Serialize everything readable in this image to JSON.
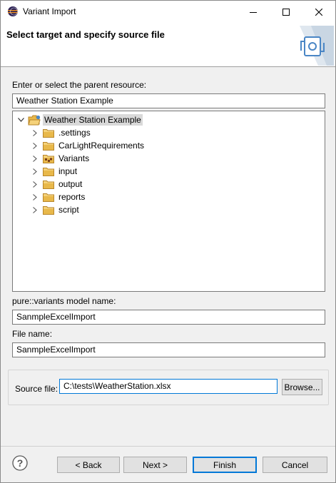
{
  "window": {
    "title": "Variant Import",
    "icon": "eclipse-icon"
  },
  "banner": {
    "title": "Select target and specify source file",
    "graphic": "import-wizard-icon"
  },
  "parent_resource": {
    "label": "Enter or select the parent resource:",
    "value": "Weather Station Example"
  },
  "tree": {
    "root": {
      "label": "Weather Station Example",
      "expanded": true,
      "icon": "open-project-folder-icon"
    },
    "children": [
      {
        "label": ".settings",
        "icon": "folder-icon"
      },
      {
        "label": "CarLightRequirements",
        "icon": "folder-icon"
      },
      {
        "label": "Variants",
        "icon": "variants-folder-icon"
      },
      {
        "label": "input",
        "icon": "folder-icon"
      },
      {
        "label": "output",
        "icon": "folder-icon"
      },
      {
        "label": "reports",
        "icon": "folder-icon"
      },
      {
        "label": "script",
        "icon": "folder-icon"
      }
    ]
  },
  "model_name": {
    "label": "pure::variants model name:",
    "value": "SanmpleExcelImport"
  },
  "file_name": {
    "label": "File name:",
    "value": "SanmpleExcelImport"
  },
  "source": {
    "label": "Source file:",
    "value": "C:\\tests\\WeatherStation.xlsx",
    "browse_label": "Browse..."
  },
  "buttons": {
    "back": "< Back",
    "next": "Next >",
    "finish": "Finish",
    "cancel": "Cancel"
  },
  "colors": {
    "accent": "#0078d7",
    "folder": "#e8b84a",
    "dialog_bg": "#f0f0f0"
  }
}
